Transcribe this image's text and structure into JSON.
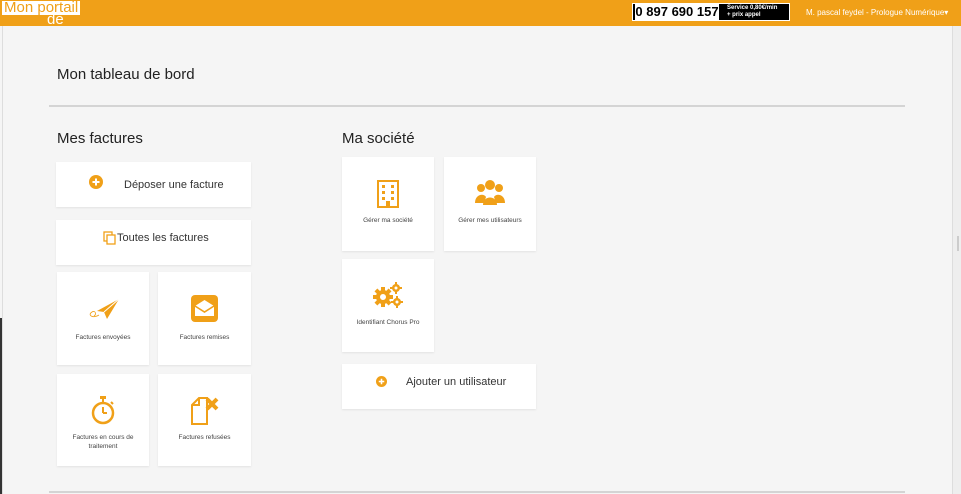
{
  "header": {
    "logo_line1": "Mon portail",
    "logo_line2": "de doc",
    "phone_number": "0 897 690 157",
    "phone_service_line1": "Service 0,80€/min",
    "phone_service_line2": "+ prix appel",
    "user_menu": "M. pascal feydel - Prologue Numérique▾"
  },
  "page": {
    "title": "Mon tableau de bord"
  },
  "invoices": {
    "title": "Mes factures",
    "upload_label": "Déposer une facture",
    "all_label": "Toutes les factures",
    "sent_label": "Factures envoyées",
    "delivered_label": "Factures remises",
    "processing_label": "Factures en cours de traitement",
    "refused_label": "Factures refusées"
  },
  "company": {
    "title": "Ma société",
    "manage_company_label": "Gérer ma société",
    "manage_users_label": "Gérer mes utilisateurs",
    "chorus_label": "Identifiant Chorus Pro",
    "add_user_label": "Ajouter un utilisateur"
  },
  "colors": {
    "accent": "#f0a018",
    "background": "#f5f5f5",
    "card": "#ffffff"
  },
  "icons": [
    "plus-circle-icon",
    "copy-icon",
    "paper-plane-icon",
    "envelope-icon",
    "stopwatch-icon",
    "file-cross-icon",
    "building-icon",
    "users-icon",
    "gears-icon"
  ]
}
